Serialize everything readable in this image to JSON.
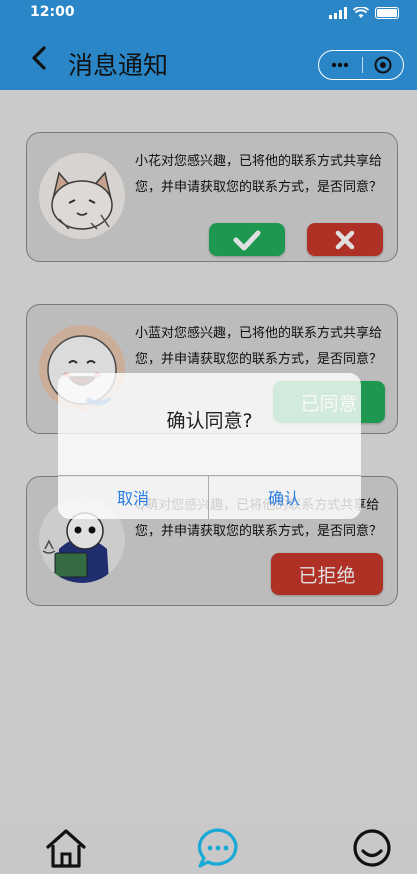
{
  "status_bar": {
    "time": "12:00"
  },
  "nav": {
    "title": "消息通知",
    "menu_icon": "more-dots-icon",
    "close_icon": "target-close-icon"
  },
  "colors": {
    "primary": "#2a86c6",
    "accept": "#23ad5c",
    "reject": "#c8382c",
    "link": "#2a7de1",
    "active_tab": "#18a9d6"
  },
  "notifications": [
    {
      "message": "小花对您感兴趣，已将他的联系方式共享给您，并申请获取您的联系方式，是否同意？",
      "avatar": "cat-avatar",
      "state": "pending"
    },
    {
      "message": "小蓝对您感兴趣，已将他的联系方式共享给您，并申请获取您的联系方式，是否同意？",
      "avatar": "cartoon-face-avatar",
      "state": "agreed",
      "status_label": "已同意"
    },
    {
      "message": "Q萌对您感兴趣，已将他的联系方式共享给您，并申请获取您的联系方式，是否同意？",
      "avatar": "reader-avatar",
      "state": "rejected",
      "status_label": "已拒绝"
    }
  ],
  "dialog": {
    "title": "确认同意?",
    "cancel_label": "取消",
    "confirm_label": "确认"
  },
  "tabbar": {
    "items": [
      {
        "icon": "home-icon",
        "active": false
      },
      {
        "icon": "chat-icon",
        "active": true
      },
      {
        "icon": "smile-icon",
        "active": false
      }
    ]
  }
}
